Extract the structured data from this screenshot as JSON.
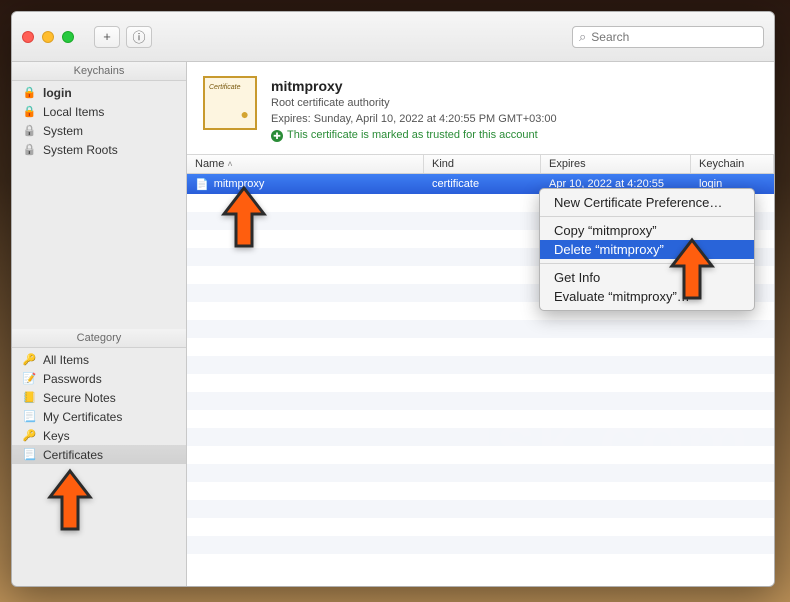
{
  "toolbar": {
    "search_placeholder": "Search",
    "plus_label": "+",
    "info_label": "ⓘ"
  },
  "sidebar": {
    "keychains_header": "Keychains",
    "category_header": "Category",
    "keychains": [
      {
        "label": "login",
        "bold": true,
        "icon": "lock-orange"
      },
      {
        "label": "Local Items",
        "bold": false,
        "icon": "lock-orange"
      },
      {
        "label": "System",
        "bold": false,
        "icon": "lock-grey"
      },
      {
        "label": "System Roots",
        "bold": false,
        "icon": "lock-grey"
      }
    ],
    "categories": [
      {
        "label": "All Items",
        "icon": "cat-icon"
      },
      {
        "label": "Passwords",
        "icon": "cat-pass"
      },
      {
        "label": "Secure Notes",
        "icon": "cat-note"
      },
      {
        "label": "My Certificates",
        "icon": "cat-cert"
      },
      {
        "label": "Keys",
        "icon": "cat-key"
      },
      {
        "label": "Certificates",
        "icon": "cat-cert"
      }
    ]
  },
  "cert_panel": {
    "name": "mitmproxy",
    "authority": "Root certificate authority",
    "expires": "Expires: Sunday, April 10, 2022 at 4:20:55 PM GMT+03:00",
    "trust": "This certificate is marked as trusted for this account"
  },
  "table": {
    "headers": {
      "name": "Name",
      "kind": "Kind",
      "expires": "Expires",
      "keychain": "Keychain"
    },
    "row": {
      "name": "mitmproxy",
      "kind": "certificate",
      "expires": "Apr 10, 2022 at 4:20:55",
      "keychain": "login"
    }
  },
  "context_menu": {
    "new_pref": "New Certificate Preference…",
    "copy": "Copy “mitmproxy”",
    "delete": "Delete “mitmproxy”",
    "get_info": "Get Info",
    "evaluate": "Evaluate “mitmproxy”…"
  }
}
